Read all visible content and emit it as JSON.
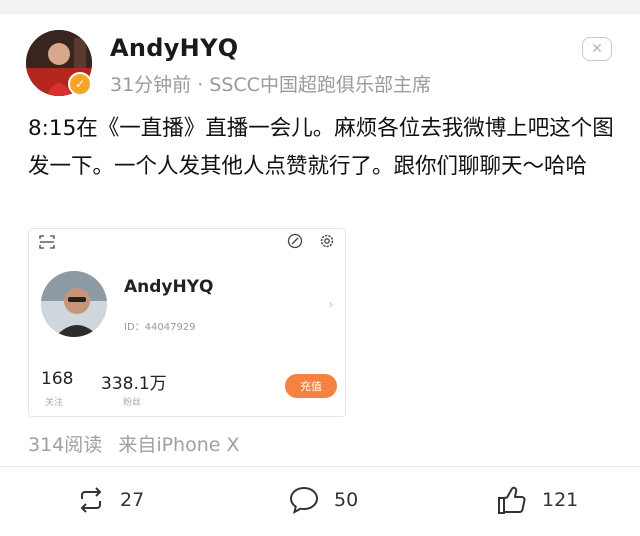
{
  "post": {
    "username": "AndyHYQ",
    "meta": "31分钟前 · SSCC中国超跑俱乐部主席",
    "text": "8:15在《一直播》直播一会儿。麻烦各位去我微博上吧这个图发一下。一个人发其他人点赞就行了。跟你们聊聊天～哈哈",
    "reads": "314阅读",
    "source": "来自iPhone X"
  },
  "card": {
    "name": "AndyHYQ",
    "id": "ID：44047929",
    "following_count": "168",
    "following_label": "关注",
    "followers_count": "338.1万",
    "followers_label": "粉丝",
    "charge_label": "充值"
  },
  "actions": {
    "repost_count": "27",
    "comment_count": "50",
    "like_count": "121"
  },
  "colors": {
    "verify_badge": "#f5a623",
    "charge_button": "#f5823e",
    "meta_text": "#9a9a9a"
  }
}
